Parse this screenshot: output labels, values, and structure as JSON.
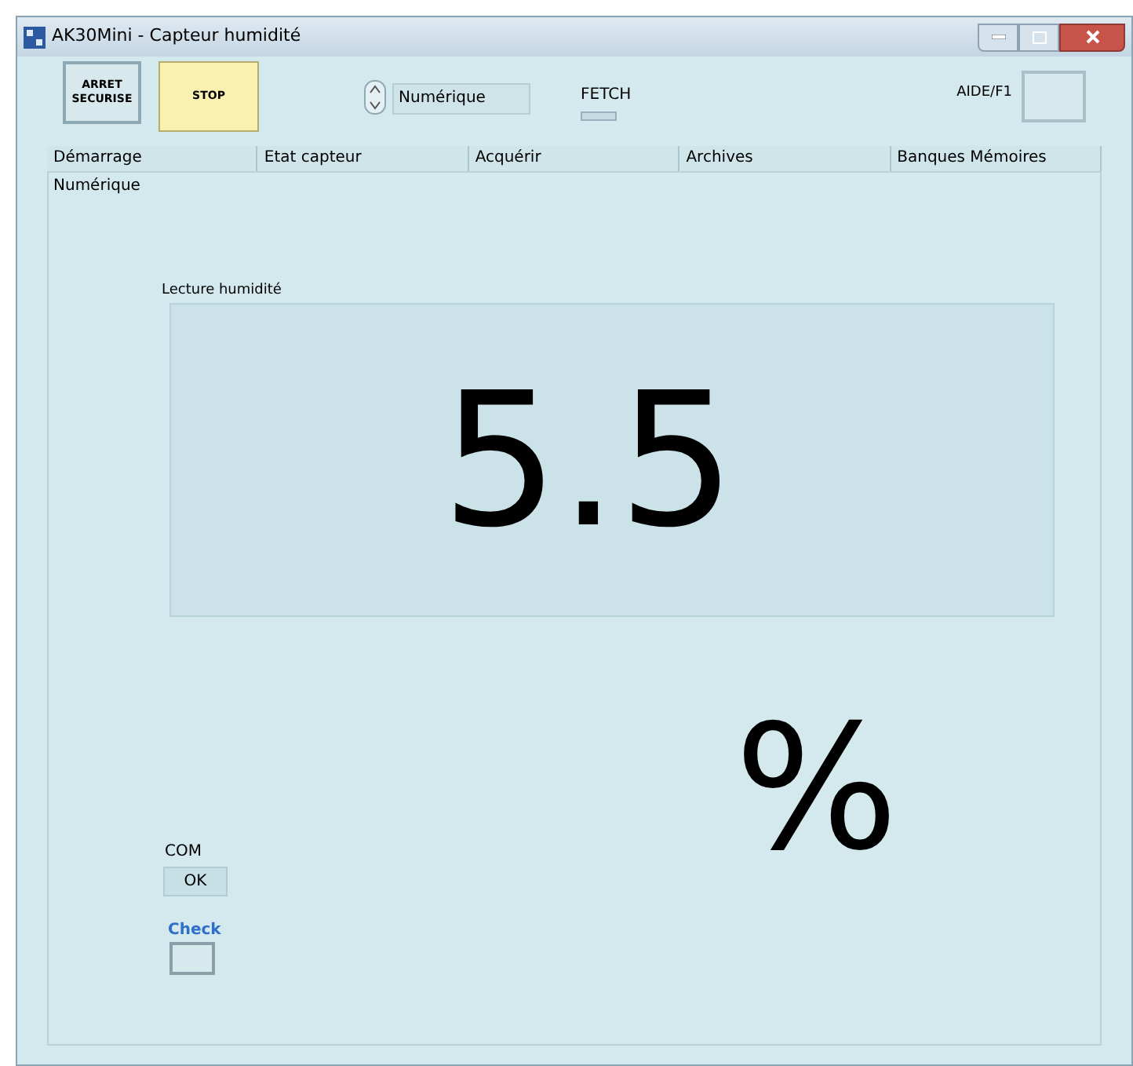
{
  "window": {
    "title": "AK30Mini - Capteur humidité"
  },
  "toolbar": {
    "safe_stop": "ARRET\nSECURISE",
    "stop": "STOP",
    "mode": "Numérique",
    "fetch": "FETCH",
    "help": "AIDE/F1"
  },
  "tabs": [
    {
      "label": "Démarrage",
      "selected": false
    },
    {
      "label": "Etat capteur",
      "selected": false
    },
    {
      "label": "Acquérir",
      "selected": false
    },
    {
      "label": "Archives",
      "selected": false
    },
    {
      "label": "Banques Mémoires",
      "selected": false
    }
  ],
  "page": {
    "title": "Numérique",
    "reading_label": "Lecture humidité",
    "reading": "5.5",
    "unit": "%",
    "com_label": "COM",
    "com_status": "OK",
    "check_label": "Check"
  }
}
